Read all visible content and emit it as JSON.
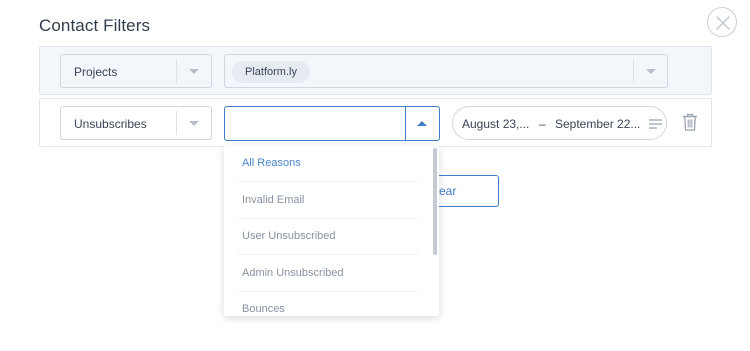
{
  "modal": {
    "title": "Contact Filters"
  },
  "filters": {
    "row1": {
      "field_label": "Projects",
      "chip_label": "Platform.ly"
    },
    "row2": {
      "field_label": "Unsubscribes",
      "reason_value": "",
      "date_from": "August 23,...",
      "date_dash": "–",
      "date_to": "September 22..."
    }
  },
  "dropdown": {
    "options": [
      {
        "label": "All Reasons",
        "selected": true
      },
      {
        "label": "Invalid Email",
        "selected": false
      },
      {
        "label": "User Unsubscribed",
        "selected": false
      },
      {
        "label": "Admin Unsubscribed",
        "selected": false
      },
      {
        "label": "Bounces",
        "selected": false
      }
    ]
  },
  "actions": {
    "clear_label_visible": "ear"
  },
  "icons": {
    "close": "close-icon",
    "trash": "trash-icon",
    "lines": "lines-icon",
    "caret": "chevron-down-icon"
  },
  "colors": {
    "accent": "#3f7ec9",
    "active_option": "#4b86cd",
    "muted_text": "#8792a2",
    "row_bg": "#f3f6fa"
  }
}
